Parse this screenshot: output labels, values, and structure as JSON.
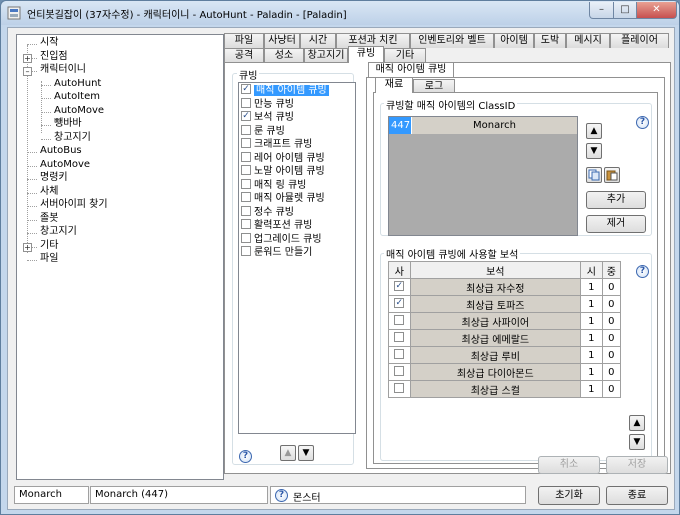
{
  "window": {
    "title": "언티봇길잡이 (37자수정) - 캐릭터이니 - AutoHunt - Paladin - [Paladin]",
    "minimize_label": "–",
    "maximize_label": "□",
    "close_label": "✕"
  },
  "tree": {
    "items": [
      {
        "label": "시작"
      },
      {
        "label": "진입점",
        "expander": "+"
      },
      {
        "label": "캐릭터이니",
        "expander": "–"
      },
      {
        "label": "AutoHunt"
      },
      {
        "label": "AutoItem"
      },
      {
        "label": "AutoMove"
      },
      {
        "label": "뺑바바"
      },
      {
        "label": "창고지기"
      },
      {
        "label": "AutoBus"
      },
      {
        "label": "AutoMove"
      },
      {
        "label": "명령키"
      },
      {
        "label": "사체"
      },
      {
        "label": "서버아이피 찾기"
      },
      {
        "label": "졸봇"
      },
      {
        "label": "창고지기"
      },
      {
        "label": "기타",
        "expander": "+"
      },
      {
        "label": "파일"
      }
    ]
  },
  "tabs_row1": [
    "파일",
    "사냥터",
    "시간",
    "포션과 치킨",
    "인벤토리와 벨트",
    "아이템",
    "도박",
    "메시지",
    "플레이어"
  ],
  "tabs_row2": [
    "공격",
    "성소",
    "창고지기",
    "큐빙",
    "기타"
  ],
  "active_tab": "큐빙",
  "cubing": {
    "group_label": "큐빙",
    "items": [
      {
        "label": "매직 아이템 큐빙",
        "checked": true,
        "selected": true
      },
      {
        "label": "만능 큐빙",
        "checked": false
      },
      {
        "label": "보석 큐빙",
        "checked": true
      },
      {
        "label": "룬 큐빙",
        "checked": false
      },
      {
        "label": "크래프트 큐빙",
        "checked": false
      },
      {
        "label": "레어 아이템 큐빙",
        "checked": false
      },
      {
        "label": "노말 아이템 큐빙",
        "checked": false
      },
      {
        "label": "매직 링 큐빙",
        "checked": false
      },
      {
        "label": "매직 아뮬렛 큐빙",
        "checked": false
      },
      {
        "label": "정수 큐빙",
        "checked": false
      },
      {
        "label": "활력포션 큐빙",
        "checked": false
      },
      {
        "label": "업그레이드 큐빙",
        "checked": false
      },
      {
        "label": "룬워드 만들기",
        "checked": false
      }
    ],
    "up_label": "▲",
    "down_label": "▼"
  },
  "magic": {
    "tab_label": "매직 아이템 큐빙",
    "subtabs": [
      "재료",
      "로그"
    ],
    "class_group_label": "큐빙할 매직 아이템의 ClassID",
    "class_list": [
      {
        "id": "447",
        "name": "Monarch"
      }
    ],
    "add_label": "추가",
    "remove_label": "제거",
    "gem_group_label": "매직 아이템 큐빙에 사용할 보석",
    "gem_headers": [
      "사",
      "보석",
      "시",
      "중"
    ],
    "gems": [
      {
        "name": "최상급 자수정",
        "checked": true,
        "a": "1",
        "b": "0"
      },
      {
        "name": "최상급 토파즈",
        "checked": true,
        "a": "1",
        "b": "0"
      },
      {
        "name": "최상급 사파이어",
        "checked": false,
        "a": "1",
        "b": "0"
      },
      {
        "name": "최상급 에메랄드",
        "checked": false,
        "a": "1",
        "b": "0"
      },
      {
        "name": "최상급 루비",
        "checked": false,
        "a": "1",
        "b": "0"
      },
      {
        "name": "최상급 다이아몬드",
        "checked": false,
        "a": "1",
        "b": "0"
      },
      {
        "name": "최상급 스컬",
        "checked": false,
        "a": "1",
        "b": "0"
      }
    ]
  },
  "bottom": {
    "cancel_label": "취소",
    "save_label": "저장",
    "reset_label": "초기화",
    "exit_label": "종료"
  },
  "status": {
    "field1": "Monarch",
    "field2": "Monarch (447)",
    "field3": "몬스터"
  },
  "colors": {
    "selection": "#3399ff",
    "window_frame": "#c4d7ec",
    "close_button": "#c75050"
  }
}
